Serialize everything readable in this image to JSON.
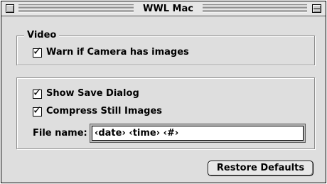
{
  "window": {
    "title": "WWL Mac"
  },
  "video_group": {
    "label": "Video",
    "warn_camera": {
      "label": "Warn if Camera has images",
      "checked": true
    }
  },
  "save_group": {
    "show_save_dialog": {
      "label": "Show Save Dialog",
      "checked": true
    },
    "compress_still_images": {
      "label": "Compress Still Images",
      "checked": true
    },
    "file_name": {
      "label": "File name:",
      "value": "‹date› ‹time› ‹#›"
    }
  },
  "footer": {
    "restore_defaults_label": "Restore Defaults"
  },
  "icons": {
    "checkmark": "☑"
  }
}
